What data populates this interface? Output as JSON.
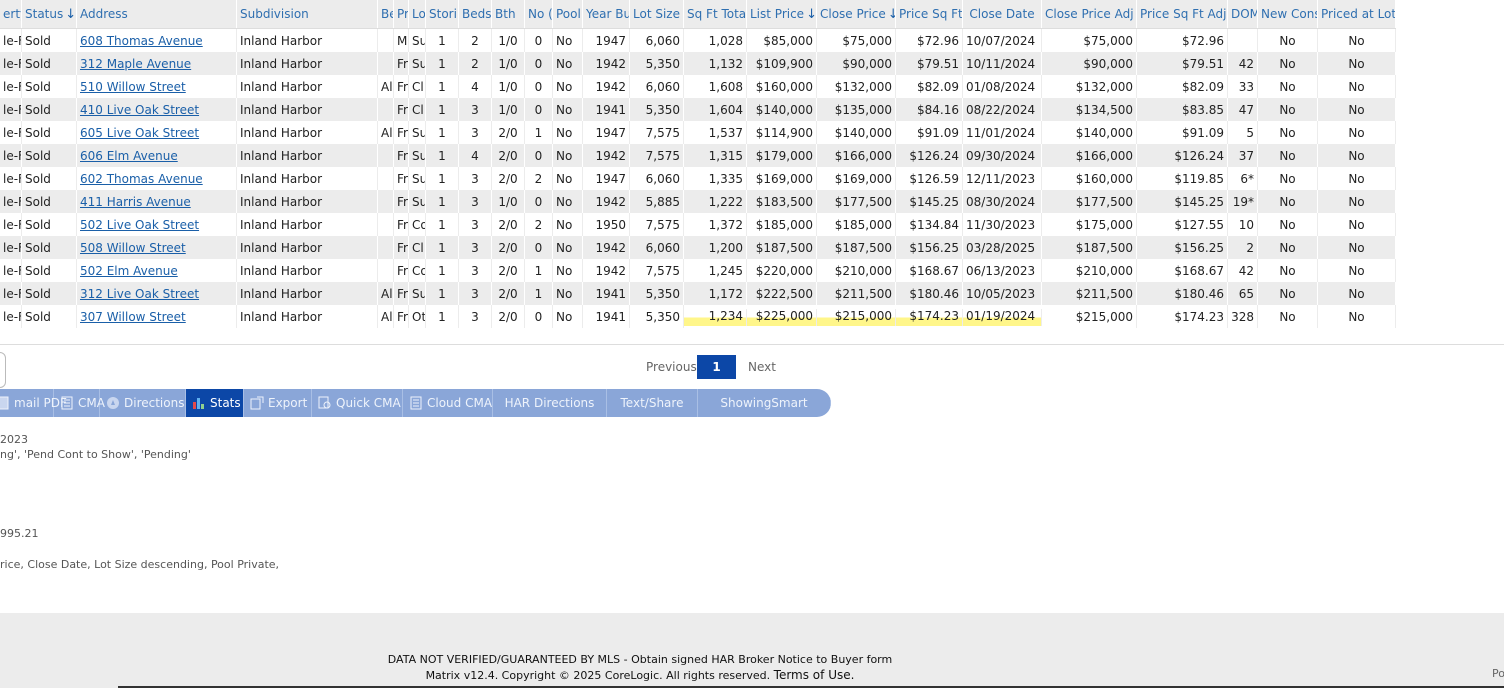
{
  "columns": [
    {
      "label": "erty",
      "sort": ""
    },
    {
      "label": "Status",
      "sort": "down"
    },
    {
      "label": "Address",
      "sort": ""
    },
    {
      "label": "Subdivision",
      "sort": ""
    },
    {
      "label": "Be",
      "sort": ""
    },
    {
      "label": "Pr",
      "sort": ""
    },
    {
      "label": "Lo",
      "sort": ""
    },
    {
      "label": "Stori",
      "sort": ""
    },
    {
      "label": "Beds",
      "sort": ""
    },
    {
      "label": "Bth",
      "sort": ""
    },
    {
      "label": "No (",
      "sort": ""
    },
    {
      "label": "Pool",
      "sort": ""
    },
    {
      "label": "Year Bu",
      "sort": ""
    },
    {
      "label": "Lot Size",
      "sort": ""
    },
    {
      "label": "Sq Ft Total",
      "sort": ""
    },
    {
      "label": "List Price",
      "sort": "down"
    },
    {
      "label": "Close Price",
      "sort": "down"
    },
    {
      "label": "Price Sq Ft",
      "sort": ""
    },
    {
      "label": "Close Date",
      "sort": ""
    },
    {
      "label": "Close Price Adj",
      "sort": ""
    },
    {
      "label": "Price Sq Ft Adj",
      "sort": ""
    },
    {
      "label": "DOM",
      "sort": ""
    },
    {
      "label": "New Cons",
      "sort": ""
    },
    {
      "label": "Priced at Lot",
      "sort": ""
    }
  ],
  "rows": [
    [
      "le-F",
      "Sold",
      "608 Thomas Avenue",
      "Inland Harbor",
      "",
      "M",
      "Su",
      "1",
      "2",
      "1/0",
      "0",
      "No",
      "1947",
      "6,060",
      "1,028",
      "$85,000",
      "$75,000",
      "$72.96",
      "10/07/2024",
      "$75,000",
      "$72.96",
      "",
      "No",
      "No"
    ],
    [
      "le-F",
      "Sold",
      "312 Maple Avenue",
      "Inland Harbor",
      "",
      "Fr",
      "Su",
      "1",
      "2",
      "1/0",
      "0",
      "No",
      "1942",
      "5,350",
      "1,132",
      "$109,900",
      "$90,000",
      "$79.51",
      "10/11/2024",
      "$90,000",
      "$79.51",
      "42",
      "No",
      "No"
    ],
    [
      "le-F",
      "Sold",
      "510 Willow Street",
      "Inland Harbor",
      "Al",
      "Fr",
      "Cl",
      "1",
      "4",
      "1/0",
      "0",
      "No",
      "1942",
      "6,060",
      "1,608",
      "$160,000",
      "$132,000",
      "$82.09",
      "01/08/2024",
      "$132,000",
      "$82.09",
      "33",
      "No",
      "No"
    ],
    [
      "le-F",
      "Sold",
      "410 Live Oak Street",
      "Inland Harbor",
      "",
      "Fr",
      "Cl",
      "1",
      "3",
      "1/0",
      "0",
      "No",
      "1941",
      "5,350",
      "1,604",
      "$140,000",
      "$135,000",
      "$84.16",
      "08/22/2024",
      "$134,500",
      "$83.85",
      "47",
      "No",
      "No"
    ],
    [
      "le-F",
      "Sold",
      "605 Live Oak Street",
      "Inland Harbor",
      "Al",
      "Fr",
      "Su",
      "1",
      "3",
      "2/0",
      "1",
      "No",
      "1947",
      "7,575",
      "1,537",
      "$114,900",
      "$140,000",
      "$91.09",
      "11/01/2024",
      "$140,000",
      "$91.09",
      "5",
      "No",
      "No"
    ],
    [
      "le-F",
      "Sold",
      "606 Elm Avenue",
      "Inland Harbor",
      "",
      "Fr",
      "Su",
      "1",
      "4",
      "2/0",
      "0",
      "No",
      "1942",
      "7,575",
      "1,315",
      "$179,000",
      "$166,000",
      "$126.24",
      "09/30/2024",
      "$166,000",
      "$126.24",
      "37",
      "No",
      "No"
    ],
    [
      "le-F",
      "Sold",
      "602 Thomas Avenue",
      "Inland Harbor",
      "",
      "Fr",
      "Su",
      "1",
      "3",
      "2/0",
      "2",
      "No",
      "1947",
      "6,060",
      "1,335",
      "$169,000",
      "$169,000",
      "$126.59",
      "12/11/2023",
      "$160,000",
      "$119.85",
      "6*",
      "No",
      "No"
    ],
    [
      "le-F",
      "Sold",
      "411 Harris Avenue",
      "Inland Harbor",
      "",
      "Fr",
      "Su",
      "1",
      "3",
      "1/0",
      "0",
      "No",
      "1942",
      "5,885",
      "1,222",
      "$183,500",
      "$177,500",
      "$145.25",
      "08/30/2024",
      "$177,500",
      "$145.25",
      "19*",
      "No",
      "No"
    ],
    [
      "le-F",
      "Sold",
      "502 Live Oak Street",
      "Inland Harbor",
      "",
      "Fr",
      "Co",
      "1",
      "3",
      "2/0",
      "2",
      "No",
      "1950",
      "7,575",
      "1,372",
      "$185,000",
      "$185,000",
      "$134.84",
      "11/30/2023",
      "$175,000",
      "$127.55",
      "10",
      "No",
      "No"
    ],
    [
      "le-F",
      "Sold",
      "508 Willow Street",
      "Inland Harbor",
      "",
      "Fr",
      "Cl",
      "1",
      "3",
      "2/0",
      "0",
      "No",
      "1942",
      "6,060",
      "1,200",
      "$187,500",
      "$187,500",
      "$156.25",
      "03/28/2025",
      "$187,500",
      "$156.25",
      "2",
      "No",
      "No"
    ],
    [
      "le-F",
      "Sold",
      "502 Elm Avenue",
      "Inland Harbor",
      "",
      "Fr",
      "Co",
      "1",
      "3",
      "2/0",
      "1",
      "No",
      "1942",
      "7,575",
      "1,245",
      "$220,000",
      "$210,000",
      "$168.67",
      "06/13/2023",
      "$210,000",
      "$168.67",
      "42",
      "No",
      "No"
    ],
    [
      "le-F",
      "Sold",
      "312 Live Oak Street",
      "Inland Harbor",
      "Al",
      "Fr",
      "Su",
      "1",
      "3",
      "2/0",
      "1",
      "No",
      "1941",
      "5,350",
      "1,172",
      "$222,500",
      "$211,500",
      "$180.46",
      "10/05/2023",
      "$211,500",
      "$180.46",
      "65",
      "No",
      "No"
    ],
    [
      "le-F",
      "Sold",
      "307 Willow Street",
      "Inland Harbor",
      "Al",
      "Fr",
      "Ot",
      "1",
      "3",
      "2/0",
      "0",
      "No",
      "1941",
      "5,350",
      "1,234",
      "$225,000",
      "$215,000",
      "$174.23",
      "01/19/2024",
      "$215,000",
      "$174.23",
      "328",
      "No",
      "No"
    ]
  ],
  "pager": {
    "prev": "Previous",
    "page": "1",
    "next": "Next"
  },
  "toolbar": [
    {
      "label": "mail PDF",
      "icon": "pdf-icon",
      "active": false
    },
    {
      "label": "CMA",
      "icon": "document-icon",
      "active": false
    },
    {
      "label": "Directions",
      "icon": "compass-icon",
      "active": false
    },
    {
      "label": "Stats",
      "icon": "bar-chart-icon",
      "active": true
    },
    {
      "label": "Export",
      "icon": "export-icon",
      "active": false
    },
    {
      "label": "Quick CMA",
      "icon": "quick-cma-icon",
      "active": false
    },
    {
      "label": "Cloud CMA",
      "icon": "document-icon",
      "active": false
    },
    {
      "label": "HAR Directions",
      "icon": "",
      "active": false
    },
    {
      "label": "Text/Share",
      "icon": "",
      "active": false
    },
    {
      "label": "ShowingSmart",
      "icon": "",
      "active": false
    }
  ],
  "criteria": [
    "2023",
    "ng', 'Pend Cont to Show', 'Pending'",
    "995.21",
    "rice, Close Date, Lot Size descending, Pool Private,"
  ],
  "footer": {
    "line1": "DATA NOT VERIFIED/GUARANTEED BY MLS - Obtain signed HAR Broker Notice to Buyer form",
    "line2_prefix": "Matrix v12.4. Copyright © 2025 CoreLogic. All rights reserved.",
    "terms": "Terms of Use.",
    "right_stub": "Po"
  },
  "colors": {
    "accent": "#0c47a7",
    "toolbar": "#8aa6d8",
    "link": "#1a5fa8",
    "highlight": "#fff68a"
  }
}
